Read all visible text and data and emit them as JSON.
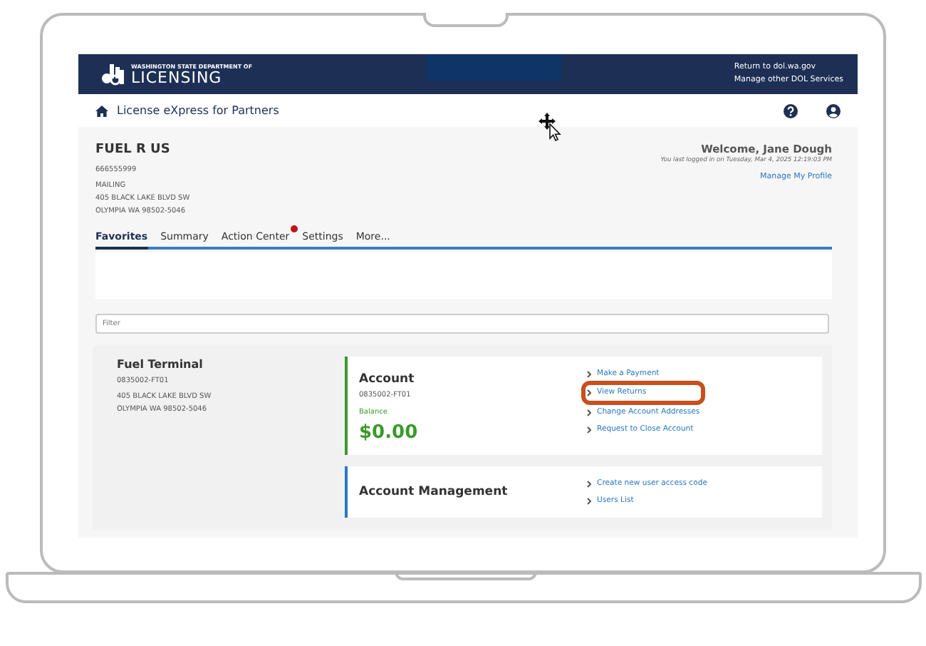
{
  "header": {
    "logo_small": "WASHINGTON STATE DEPARTMENT OF",
    "logo_big": "LICENSING",
    "links": [
      "Return to dol.wa.gov",
      "Manage other DOL Services"
    ]
  },
  "subheader": {
    "title": "License eXpress for Partners"
  },
  "business": {
    "name": "FUEL R US",
    "id": "666555999",
    "address_label": "MAILING",
    "address": [
      "405 BLACK LAKE BLVD SW",
      "OLYMPIA WA 98502-5046"
    ]
  },
  "user": {
    "welcome": "Welcome, Jane Dough",
    "last_login": "You last logged in on Tuesday, Mar 4, 2025 12:19:03 PM",
    "profile_link": "Manage My Profile"
  },
  "tabs": [
    {
      "label": "Favorites",
      "selected": true,
      "badge": false
    },
    {
      "label": "Summary",
      "selected": false,
      "badge": false
    },
    {
      "label": "Action Center",
      "selected": false,
      "badge": true
    },
    {
      "label": "Settings",
      "selected": false,
      "badge": false
    },
    {
      "label": "More...",
      "selected": false,
      "badge": false
    }
  ],
  "filter": {
    "placeholder": "Filter"
  },
  "location": {
    "name": "Fuel Terminal",
    "id": "0835002-FT01",
    "address": [
      "405 BLACK LAKE BLVD SW",
      "OLYMPIA WA 98502-5046"
    ]
  },
  "panels": [
    {
      "title": "Account",
      "id": "0835002-FT01",
      "balance_label": "Balance",
      "balance": "$0.00",
      "color": "#3a9a2a",
      "links": [
        {
          "label": "Make a Payment",
          "highlighted": false
        },
        {
          "label": "View Returns",
          "highlighted": true
        },
        {
          "label": "Change Account Addresses",
          "highlighted": false
        },
        {
          "label": "Request to Close Account",
          "highlighted": false
        }
      ]
    },
    {
      "title": "Account Management",
      "color": "#2a78c0",
      "links": [
        {
          "label": "Create new user access code",
          "highlighted": false
        },
        {
          "label": "Users List",
          "highlighted": false
        }
      ]
    }
  ]
}
